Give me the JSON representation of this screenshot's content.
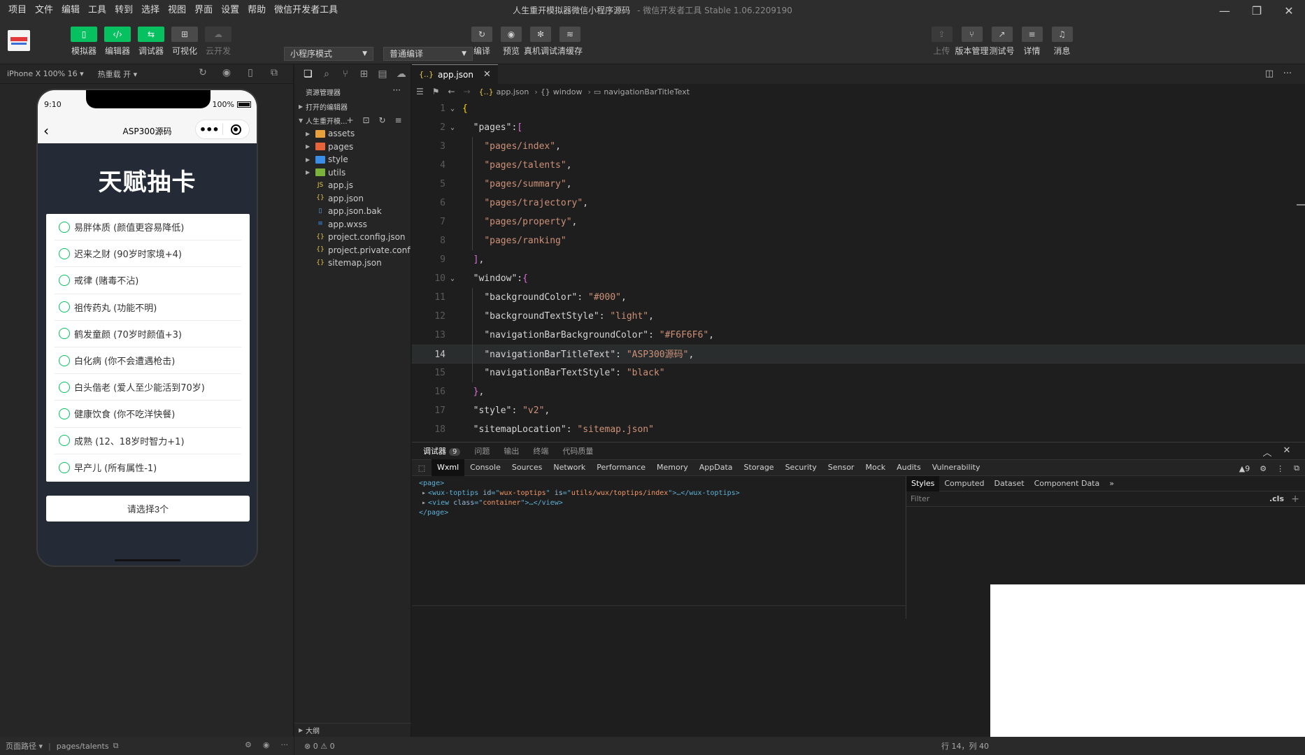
{
  "menu": [
    "项目",
    "文件",
    "编辑",
    "工具",
    "转到",
    "选择",
    "视图",
    "界面",
    "设置",
    "帮助",
    "微信开发者工具"
  ],
  "window": {
    "title": "人生重开模拟器微信小程序源码",
    "subtitle": "- 微信开发者工具 Stable 1.06.2209190"
  },
  "toolbar": {
    "left_buttons": [
      {
        "label": "模拟器",
        "icon": "phone-icon",
        "glyph": "▯",
        "style": "green"
      },
      {
        "label": "编辑器",
        "icon": "code-icon",
        "glyph": "‹/›",
        "style": "green"
      },
      {
        "label": "调试器",
        "icon": "debug-icon",
        "glyph": "⇆",
        "style": "green"
      },
      {
        "label": "可视化",
        "icon": "layout-icon",
        "glyph": "⊞",
        "style": "gray"
      },
      {
        "label": "云开发",
        "icon": "cloud-icon",
        "glyph": "☁",
        "style": "dim"
      }
    ],
    "mode_select": "小程序模式",
    "compile_select": "普通编译",
    "mid_buttons": [
      {
        "label": "编译",
        "icon": "refresh-icon",
        "glyph": "↻"
      },
      {
        "label": "预览",
        "icon": "eye-icon",
        "glyph": "◉"
      },
      {
        "label": "真机调试",
        "icon": "bug-icon",
        "glyph": "✻"
      },
      {
        "label": "清缓存",
        "icon": "layers-icon",
        "glyph": "≋"
      }
    ],
    "right_buttons": [
      {
        "label": "上传",
        "icon": "upload-icon",
        "glyph": "⇪",
        "dim": true
      },
      {
        "label": "版本管理",
        "icon": "branch-icon",
        "glyph": "⑂",
        "dim": false
      },
      {
        "label": "测试号",
        "icon": "external-icon",
        "glyph": "↗",
        "dim": false
      },
      {
        "label": "详情",
        "icon": "menu-icon",
        "glyph": "≡",
        "dim": false
      },
      {
        "label": "消息",
        "icon": "bell-icon",
        "glyph": "♫",
        "dim": false
      }
    ]
  },
  "simulator": {
    "device": "iPhone X 100% 16 ▾",
    "hotreload": "热重载 开 ▾",
    "status_time": "9:10",
    "battery": "100%",
    "nav_title": "ASP300源码",
    "heading": "天赋抽卡",
    "cards": [
      "易胖体质 (颜值更容易降低)",
      "迟来之财 (90岁时家境+4)",
      "戒律 (赌毒不沾)",
      "祖传药丸 (功能不明)",
      "鹤发童颜 (70岁时颜值+3)",
      "白化病 (你不会遭遇枪击)",
      "白头偕老 (爱人至少能活到70岁)",
      "健康饮食 (你不吃洋快餐)",
      "成熟 (12、18岁时智力+1)",
      "早产儿 (所有属性-1)"
    ],
    "confirm": "请选择3个"
  },
  "explorer": {
    "title": "资源管理器",
    "open_editors": "打开的编辑器",
    "project": "人生重开模...",
    "tree": [
      {
        "name": "assets",
        "type": "folder",
        "color": "#e8a13a"
      },
      {
        "name": "pages",
        "type": "folder",
        "color": "#e8633a"
      },
      {
        "name": "style",
        "type": "folder",
        "color": "#3a8ee8"
      },
      {
        "name": "utils",
        "type": "folder",
        "color": "#7bb23a"
      },
      {
        "name": "app.js",
        "type": "file",
        "color": "#e8c84a"
      },
      {
        "name": "app.json",
        "type": "file",
        "color": "#e8c84a"
      },
      {
        "name": "app.json.bak",
        "type": "file",
        "color": "#6aa0e8"
      },
      {
        "name": "app.wxss",
        "type": "file",
        "color": "#3a8ee8"
      },
      {
        "name": "project.config.json",
        "type": "file",
        "color": "#e8c84a"
      },
      {
        "name": "project.private.config.js...",
        "type": "file",
        "color": "#e8c84a"
      },
      {
        "name": "sitemap.json",
        "type": "file",
        "color": "#e8c84a"
      }
    ],
    "outline": "大纲"
  },
  "editor": {
    "tab": "app.json",
    "breadcrumb": [
      "app.json",
      "window",
      "navigationBarTitleText"
    ],
    "lines": [
      "{",
      "  \"pages\":[",
      "    \"pages/index\",",
      "    \"pages/talents\",",
      "    \"pages/summary\",",
      "    \"pages/trajectory\",",
      "    \"pages/property\",",
      "    \"pages/ranking\"",
      "  ],",
      "  \"window\":{",
      "    \"backgroundColor\": \"#000\",",
      "    \"backgroundTextStyle\": \"light\",",
      "    \"navigationBarBackgroundColor\": \"#F6F6F6\",",
      "    \"navigationBarTitleText\": \"ASP300源码\",",
      "    \"navigationBarTextStyle\": \"black\"",
      "  },",
      "  \"style\": \"v2\",",
      "  \"sitemapLocation\": \"sitemap.json\"",
      "}"
    ],
    "current_line": 14
  },
  "debugger": {
    "tabs": [
      "调试器",
      "问题",
      "输出",
      "终端",
      "代码质量"
    ],
    "badge": "9",
    "devtools_tabs": [
      "Wxml",
      "Console",
      "Sources",
      "Network",
      "Performance",
      "Memory",
      "AppData",
      "Storage",
      "Security",
      "Sensor",
      "Mock",
      "Audits",
      "Vulnerability"
    ],
    "warnings": "▲9",
    "wxml": {
      "root_open": "<page>",
      "line1_tag": "wux-toptips",
      "line1_id": "wux-toptips",
      "line1_is": "utils/wux/toptips/index",
      "line2_tag": "view",
      "line2_class": "container",
      "root_close": "</page>"
    },
    "style_tabs": [
      "Styles",
      "Computed",
      "Dataset",
      "Component Data"
    ],
    "filter_placeholder": "Filter",
    "cls": ".cls"
  },
  "statusbar": {
    "page_path_label": "页面路径 ▾",
    "page_path": "pages/talents",
    "problems": "⊗ 0 ⚠ 0",
    "position": "行 14，列 40"
  }
}
